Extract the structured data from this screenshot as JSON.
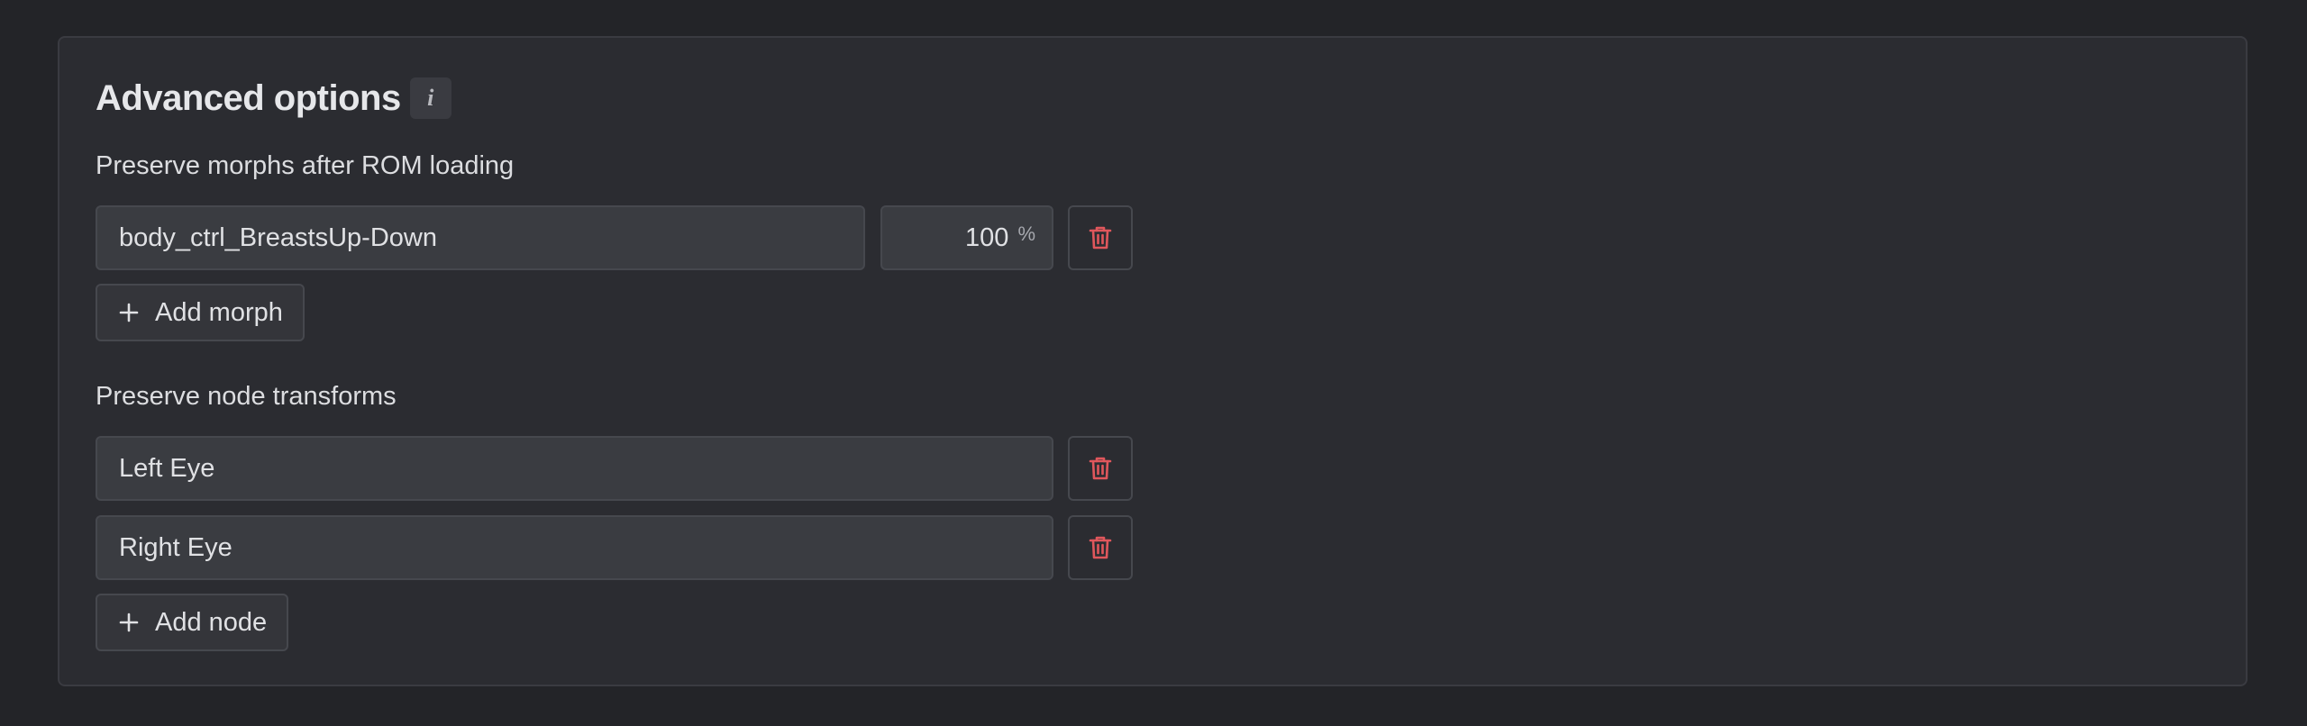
{
  "panel": {
    "title": "Advanced options",
    "info_icon": "info-icon",
    "info_glyph": "i"
  },
  "morphs": {
    "label": "Preserve morphs after ROM loading",
    "items": [
      {
        "name": "body_ctrl_BreastsUp-Down",
        "value": "100",
        "unit": "%"
      }
    ],
    "add_label": "Add morph",
    "delete_icon": "trash-icon",
    "add_icon": "plus-icon"
  },
  "nodes": {
    "label": "Preserve node transforms",
    "items": [
      {
        "name": "Left Eye"
      },
      {
        "name": "Right Eye"
      }
    ],
    "add_label": "Add node",
    "delete_icon": "trash-icon",
    "add_icon": "plus-icon"
  },
  "colors": {
    "background": "#232428",
    "panel": "#2b2c31",
    "danger": "#e0575c"
  }
}
